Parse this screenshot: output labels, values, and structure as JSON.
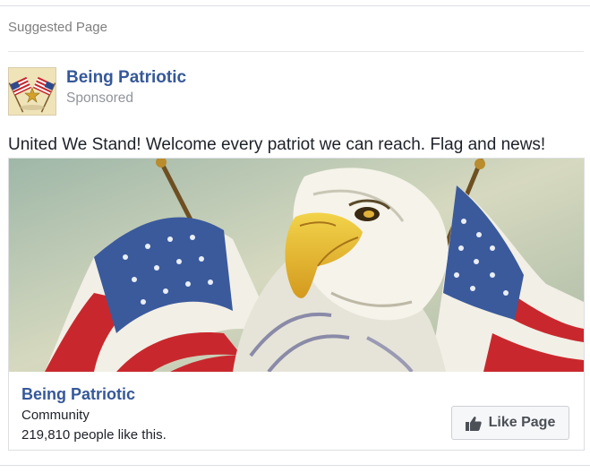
{
  "card": {
    "header": "Suggested Page",
    "page_name": "Being Patriotic",
    "sponsored_label": "Sponsored",
    "post_text": "United We Stand! Welcome every patriot we can reach. Flag and news!",
    "avatar_icon": "crossed-flags-eagle-icon"
  },
  "ad": {
    "image_subject": "bald-eagle-with-american-flags",
    "page_name": "Being Patriotic",
    "category": "Community",
    "likes_text": "219,810 people like this.",
    "like_button_label": "Like Page",
    "like_icon": "thumbs-up-icon"
  },
  "colors": {
    "link_blue": "#365899",
    "muted_gray": "#90949c",
    "button_bg": "#f6f7f9",
    "border": "#dddfe2"
  }
}
